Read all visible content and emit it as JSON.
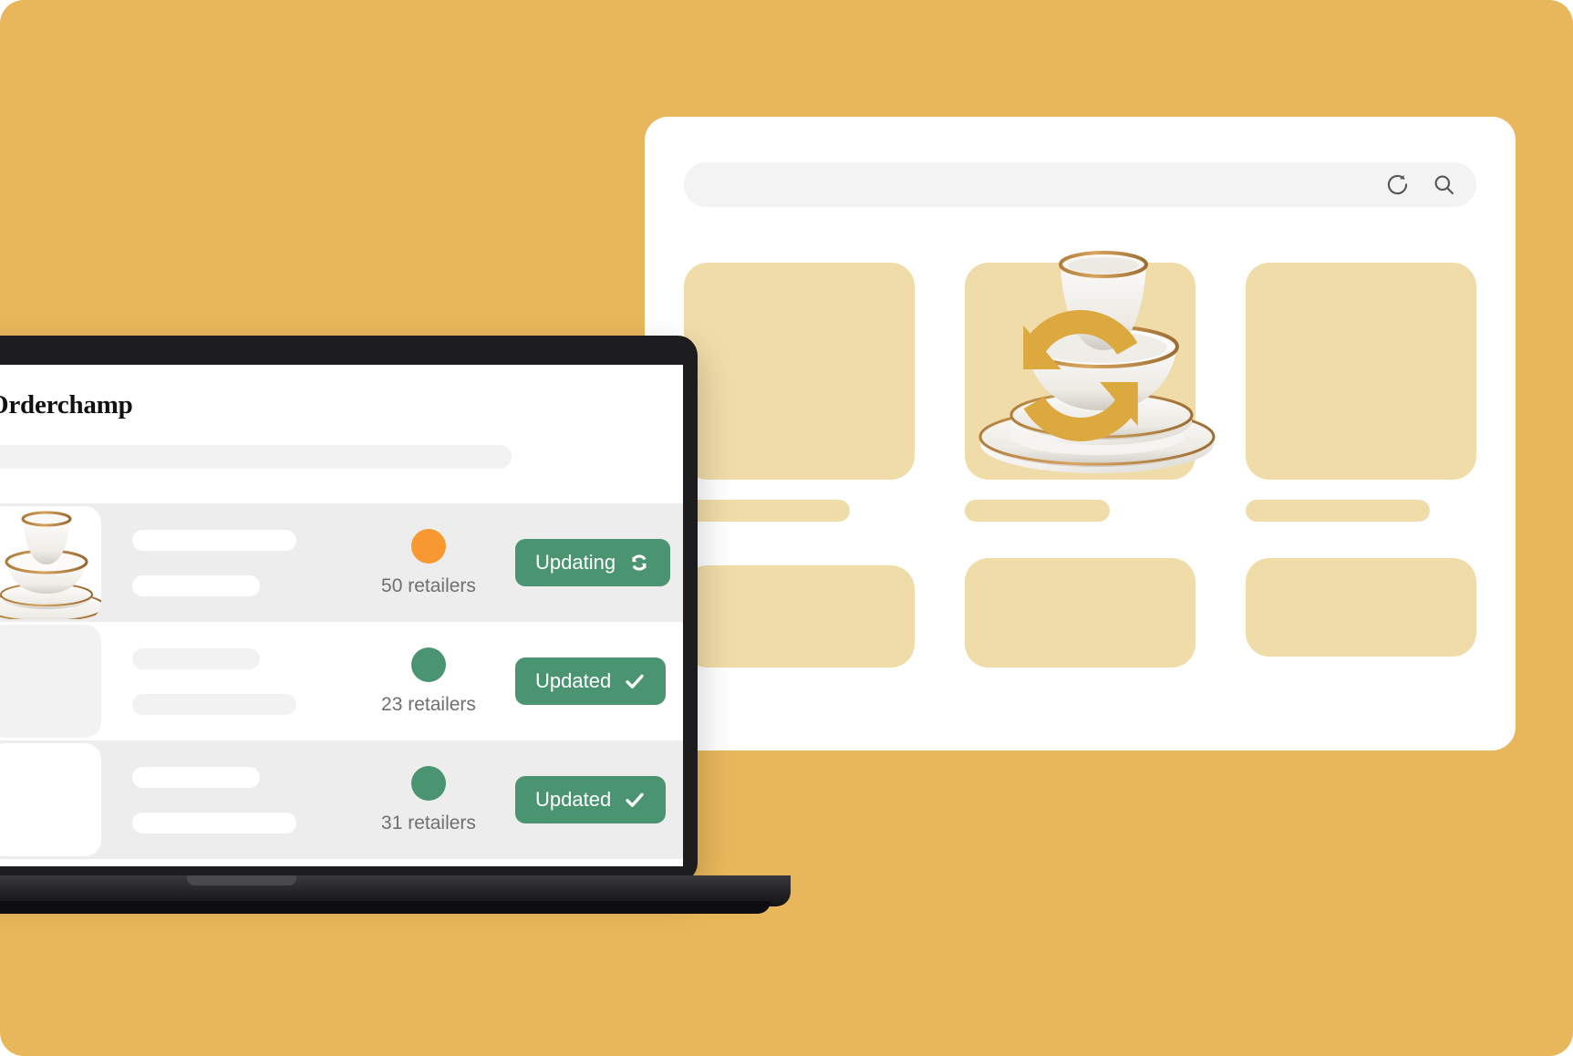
{
  "theme": {
    "page_background": "#E9B75B",
    "tile_background": "#F0DCA8",
    "accent_green": "#4A9471",
    "accent_orange": "#F89830",
    "sync_icon_color": "#DCA93F",
    "row_shade": "#EDEDED",
    "text_muted": "#6F6F6F"
  },
  "browser": {
    "addressbar": {
      "value": "",
      "placeholder": "",
      "reload_icon": "reload-icon",
      "search_icon": "search-icon"
    },
    "grid": {
      "row1": [
        {
          "name": "product-tile-1",
          "caption_width": "w-mid"
        },
        {
          "name": "product-tile-featured",
          "caption_width": "w-short",
          "overlay_icon": "sync-icon"
        },
        {
          "name": "product-tile-3",
          "caption_width": "w-long"
        }
      ],
      "row2": [
        {
          "name": "product-tile-4"
        },
        {
          "name": "product-tile-5"
        },
        {
          "name": "product-tile-6"
        }
      ]
    }
  },
  "app": {
    "logo": "Orderchamp",
    "search_placeholder": "",
    "rows": [
      {
        "id": "row-1",
        "shade": "shaded",
        "has_photo": true,
        "dot_color": "#F89830",
        "retailers": "50 retailers",
        "action_label": "Updating",
        "action_icon": "sync-icon"
      },
      {
        "id": "row-2",
        "shade": "plain",
        "has_photo": false,
        "dot_color": "#4A9471",
        "retailers": "23 retailers",
        "action_label": "Updated",
        "action_icon": "check-icon"
      },
      {
        "id": "row-3",
        "shade": "shaded",
        "has_photo": false,
        "dot_color": "#4A9471",
        "retailers": "31 retailers",
        "action_label": "Updated",
        "action_icon": "check-icon"
      }
    ]
  }
}
